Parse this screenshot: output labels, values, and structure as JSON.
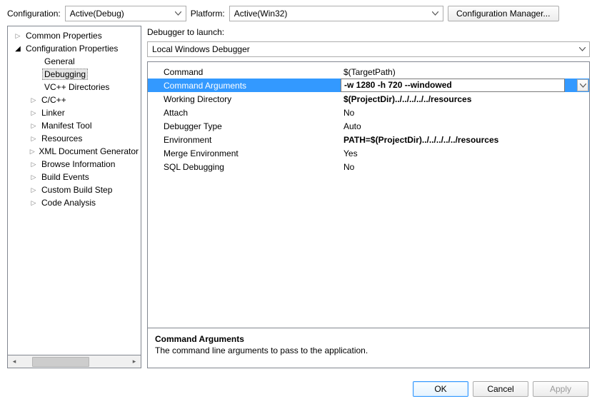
{
  "topbar": {
    "configuration_label": "Configuration:",
    "configuration_value": "Active(Debug)",
    "platform_label": "Platform:",
    "platform_value": "Active(Win32)",
    "config_manager_label": "Configuration Manager..."
  },
  "tree": {
    "common_properties": "Common Properties",
    "configuration_properties": "Configuration Properties",
    "children": {
      "general": "General",
      "debugging": "Debugging",
      "vcpp_directories": "VC++ Directories",
      "ccpp": "C/C++",
      "linker": "Linker",
      "manifest_tool": "Manifest Tool",
      "resources": "Resources",
      "xml_doc_generator": "XML Document Generator",
      "browse_information": "Browse Information",
      "build_events": "Build Events",
      "custom_build_step": "Custom Build Step",
      "code_analysis": "Code Analysis"
    }
  },
  "debugger_label": "Debugger to launch:",
  "debugger_value": "Local Windows Debugger",
  "grid": {
    "command": {
      "k": "Command",
      "v": "$(TargetPath)"
    },
    "command_arguments": {
      "k": "Command Arguments",
      "v": "-w 1280 -h 720 --windowed"
    },
    "working_directory": {
      "k": "Working Directory",
      "v": "$(ProjectDir)../../../../../resources"
    },
    "attach": {
      "k": "Attach",
      "v": "No"
    },
    "debugger_type": {
      "k": "Debugger Type",
      "v": "Auto"
    },
    "environment": {
      "k": "Environment",
      "v": "PATH=$(ProjectDir)../../../../../resources"
    },
    "merge_environment": {
      "k": "Merge Environment",
      "v": "Yes"
    },
    "sql_debugging": {
      "k": "SQL Debugging",
      "v": "No"
    }
  },
  "description": {
    "title": "Command Arguments",
    "text": "The command line arguments to pass to the application."
  },
  "footer": {
    "ok": "OK",
    "cancel": "Cancel",
    "apply": "Apply"
  }
}
